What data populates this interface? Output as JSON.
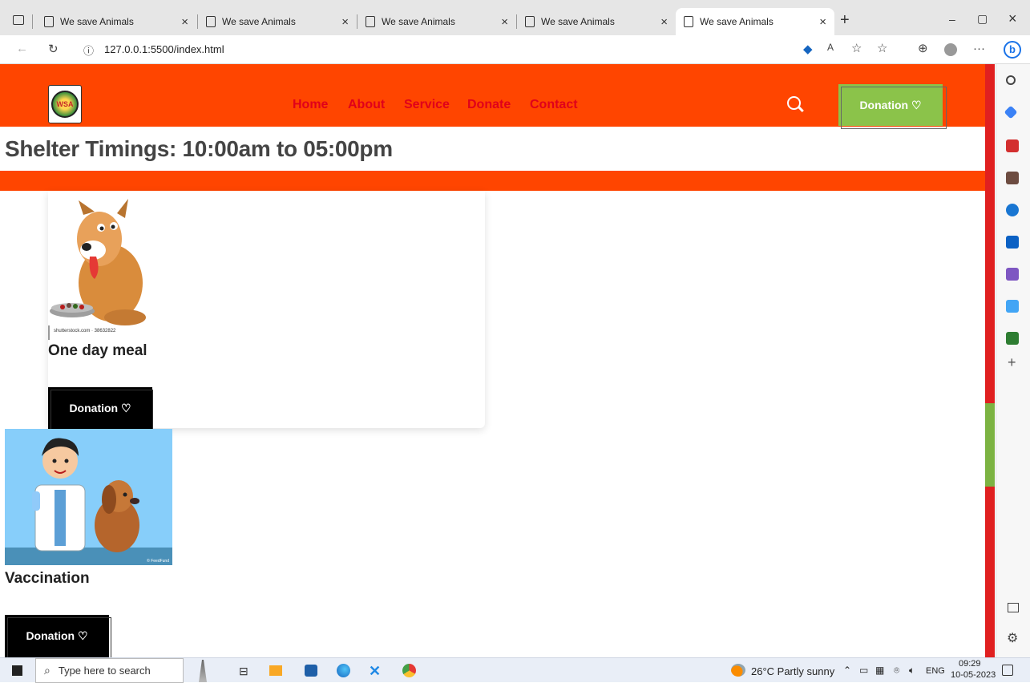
{
  "browser": {
    "tabs": [
      {
        "title": "We save Animals"
      },
      {
        "title": "We save Animals"
      },
      {
        "title": "We save Animals"
      },
      {
        "title": "We save Animals"
      },
      {
        "title": "We save Animals"
      }
    ],
    "address": "127.0.0.1:5500/index.html",
    "new_tab": "+",
    "close": "×",
    "minimize": "–",
    "restore": "▢",
    "more": "···"
  },
  "site": {
    "logo_text": "WSA",
    "nav": [
      "Home",
      "About",
      "Service",
      "Donate",
      "Contact"
    ],
    "header_button": "Donation ♡",
    "timings": "Shelter Timings: 10:00am to 05:00pm"
  },
  "cards": [
    {
      "image_caption": "shutterstock.com · 38632822",
      "title": "One day meal",
      "button": "Donation ♡"
    },
    {
      "image_caption": "© FeedFund",
      "title": "Vaccination",
      "button": "Donation ♡"
    }
  ],
  "taskbar": {
    "search_placeholder": "Type here to search",
    "weather": "26°C  Partly sunny",
    "lang": "ENG",
    "time": "09:29",
    "date": "10-05-2023"
  },
  "colors": {
    "header": "#ff4500",
    "nav_link": "#e0001a",
    "donation_green": "#8bc34a",
    "scroll_red": "#e02020"
  }
}
